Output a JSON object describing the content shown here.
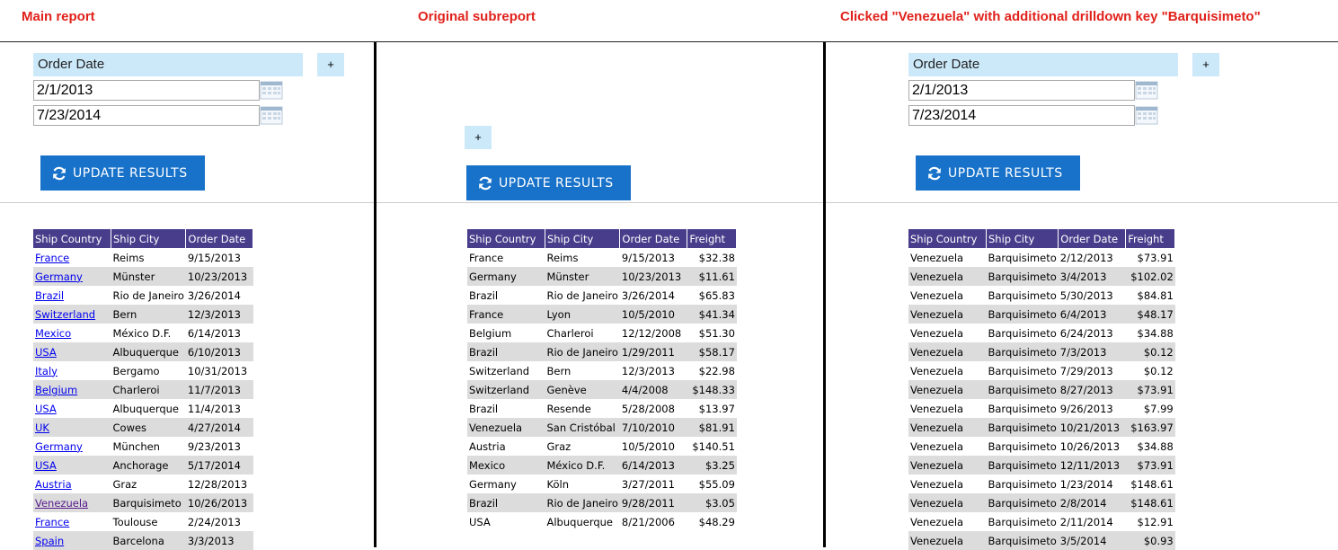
{
  "headings": {
    "main": "Main report",
    "original": "Original subreport",
    "clicked": "Clicked \"Venezuela\" with additional drilldown key \"Barquisimeto\""
  },
  "filter": {
    "label": "Order Date",
    "plus": "+",
    "start": "2/1/2013",
    "end": "7/23/2014",
    "update": "UPDATE RESULTS"
  },
  "colors": {
    "accent": "#1872c9",
    "header": "#483d8b",
    "label_bg": "#cce9fa",
    "heading": "#e0211b"
  },
  "icons": {
    "update": "refresh-icon",
    "calendar": "calendar-icon"
  },
  "main_table": {
    "headers": [
      "Ship Country",
      "Ship City",
      "Order Date"
    ],
    "rows": [
      [
        "France",
        "Reims",
        "9/15/2013"
      ],
      [
        "Germany",
        "Münster",
        "10/23/2013"
      ],
      [
        "Brazil",
        "Rio de Janeiro",
        "3/26/2014"
      ],
      [
        "Switzerland",
        "Bern",
        "12/3/2013"
      ],
      [
        "Mexico",
        "México D.F.",
        "6/14/2013"
      ],
      [
        "USA",
        "Albuquerque",
        "6/10/2013"
      ],
      [
        "Italy",
        "Bergamo",
        "10/31/2013"
      ],
      [
        "Belgium",
        "Charleroi",
        "11/7/2013"
      ],
      [
        "USA",
        "Albuquerque",
        "11/4/2013"
      ],
      [
        "UK",
        "Cowes",
        "4/27/2014"
      ],
      [
        "Germany",
        "München",
        "9/23/2013"
      ],
      [
        "USA",
        "Anchorage",
        "5/17/2014"
      ],
      [
        "Austria",
        "Graz",
        "12/28/2013"
      ],
      [
        "Venezuela",
        "Barquisimeto",
        "10/26/2013"
      ],
      [
        "France",
        "Toulouse",
        "2/24/2013"
      ],
      [
        "Spain",
        "Barcelona",
        "3/3/2013"
      ]
    ]
  },
  "sub_table": {
    "headers": [
      "Ship Country",
      "Ship City",
      "Order Date",
      "Freight"
    ],
    "rows": [
      [
        "France",
        "Reims",
        "9/15/2013",
        "$32.38"
      ],
      [
        "Germany",
        "Münster",
        "10/23/2013",
        "$11.61"
      ],
      [
        "Brazil",
        "Rio de Janeiro",
        "3/26/2014",
        "$65.83"
      ],
      [
        "France",
        "Lyon",
        "10/5/2010",
        "$41.34"
      ],
      [
        "Belgium",
        "Charleroi",
        "12/12/2008",
        "$51.30"
      ],
      [
        "Brazil",
        "Rio de Janeiro",
        "1/29/2011",
        "$58.17"
      ],
      [
        "Switzerland",
        "Bern",
        "12/3/2013",
        "$22.98"
      ],
      [
        "Switzerland",
        "Genève",
        "4/4/2008",
        "$148.33"
      ],
      [
        "Brazil",
        "Resende",
        "5/28/2008",
        "$13.97"
      ],
      [
        "Venezuela",
        "San Cristóbal",
        "7/10/2010",
        "$81.91"
      ],
      [
        "Austria",
        "Graz",
        "10/5/2010",
        "$140.51"
      ],
      [
        "Mexico",
        "México D.F.",
        "6/14/2013",
        "$3.25"
      ],
      [
        "Germany",
        "Köln",
        "3/27/2011",
        "$55.09"
      ],
      [
        "Brazil",
        "Rio de Janeiro",
        "9/28/2011",
        "$3.05"
      ],
      [
        "USA",
        "Albuquerque",
        "8/21/2006",
        "$48.29"
      ]
    ]
  },
  "drill_table": {
    "headers": [
      "Ship Country",
      "Ship City",
      "Order Date",
      "Freight"
    ],
    "rows": [
      [
        "Venezuela",
        "Barquisimeto",
        "2/12/2013",
        "$73.91"
      ],
      [
        "Venezuela",
        "Barquisimeto",
        "3/4/2013",
        "$102.02"
      ],
      [
        "Venezuela",
        "Barquisimeto",
        "5/30/2013",
        "$84.81"
      ],
      [
        "Venezuela",
        "Barquisimeto",
        "6/4/2013",
        "$48.17"
      ],
      [
        "Venezuela",
        "Barquisimeto",
        "6/24/2013",
        "$34.88"
      ],
      [
        "Venezuela",
        "Barquisimeto",
        "7/3/2013",
        "$0.12"
      ],
      [
        "Venezuela",
        "Barquisimeto",
        "7/29/2013",
        "$0.12"
      ],
      [
        "Venezuela",
        "Barquisimeto",
        "8/27/2013",
        "$73.91"
      ],
      [
        "Venezuela",
        "Barquisimeto",
        "9/26/2013",
        "$7.99"
      ],
      [
        "Venezuela",
        "Barquisimeto",
        "10/21/2013",
        "$163.97"
      ],
      [
        "Venezuela",
        "Barquisimeto",
        "10/26/2013",
        "$34.88"
      ],
      [
        "Venezuela",
        "Barquisimeto",
        "12/11/2013",
        "$73.91"
      ],
      [
        "Venezuela",
        "Barquisimeto",
        "1/23/2014",
        "$148.61"
      ],
      [
        "Venezuela",
        "Barquisimeto",
        "2/8/2014",
        "$148.61"
      ],
      [
        "Venezuela",
        "Barquisimeto",
        "2/11/2014",
        "$12.91"
      ],
      [
        "Venezuela",
        "Barquisimeto",
        "3/5/2014",
        "$0.93"
      ]
    ]
  }
}
